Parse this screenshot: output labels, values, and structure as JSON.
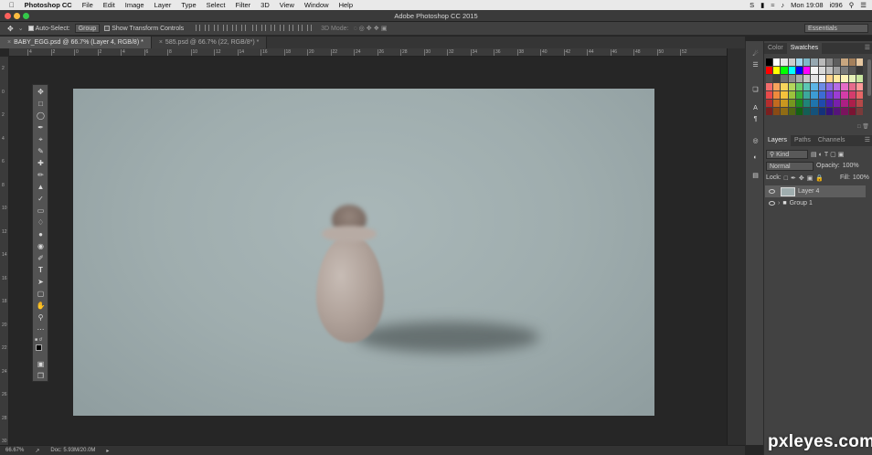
{
  "menubar": {
    "apple_icon": "apple-icon",
    "app_name": "Photoshop CC",
    "items": [
      "File",
      "Edit",
      "Image",
      "Layer",
      "Type",
      "Select",
      "Filter",
      "3D",
      "View",
      "Window",
      "Help"
    ],
    "clock": "Mon 19:08",
    "user": "i096"
  },
  "window": {
    "title": "Adobe Photoshop CC 2015"
  },
  "options": {
    "auto_select_label": "Auto-Select:",
    "auto_select_value": "Group",
    "show_transform_label": "Show Transform Controls",
    "mode_3d": "3D Mode:",
    "workspace": "Essentials"
  },
  "tabs": [
    {
      "label": "BABY_EGG.psd @ 66.7% (Layer 4, RGB/8) *",
      "active": true
    },
    {
      "label": "585.psd @ 66.7% (22, RGB/8*) *",
      "active": false
    }
  ],
  "ruler_top": [
    "4",
    "2",
    "0",
    "2",
    "4",
    "6",
    "8",
    "10",
    "12",
    "14",
    "16",
    "18",
    "20",
    "22",
    "24",
    "26",
    "28",
    "30",
    "32",
    "34",
    "36",
    "38",
    "40",
    "42",
    "44",
    "46",
    "48",
    "50",
    "52"
  ],
  "ruler_left": [
    "2",
    "0",
    "2",
    "4",
    "6",
    "8",
    "10",
    "12",
    "14",
    "16",
    "18",
    "20",
    "22",
    "24",
    "26",
    "28",
    "30"
  ],
  "status": {
    "zoom": "66.67%",
    "doc": "Doc: 5.93M/20.0M"
  },
  "color_panel": {
    "tabs": [
      "Color",
      "Swatches"
    ],
    "active": "Swatches"
  },
  "swatches": [
    "#000000",
    "#ffffff",
    "#e6e6e6",
    "#cccccc",
    "#a3d6ee",
    "#7fb8c9",
    "#96a8b0",
    "#b9b9b9",
    "#8a8a8a",
    "#5d5d5d",
    "#c8a67f",
    "#a37f5b",
    "#e6c7a0",
    "#ff0000",
    "#ffff00",
    "#00ff00",
    "#00ffff",
    "#0000ff",
    "#ff00ff",
    "#f5f5f5",
    "#d9d9d9",
    "#c0c0c0",
    "#9e9e9e",
    "#7a7a7a",
    "#585858",
    "#363636",
    "#4d4d4d",
    "#3d3d3d",
    "#6e6e6e",
    "#8c8c8c",
    "#aaaaaa",
    "#c7c7c7",
    "#e3e3e3",
    "#f2f2f2",
    "#ffd38c",
    "#ffeaa0",
    "#fff3b8",
    "#e5f0b8",
    "#c9e6a0",
    "#f26c6c",
    "#f7a35c",
    "#f7d45c",
    "#b5d65c",
    "#6ccf6c",
    "#5cc7b5",
    "#5cb5e6",
    "#6c8ce6",
    "#8c6ce6",
    "#b56ce6",
    "#e66cc7",
    "#e66c8c",
    "#ff9999",
    "#e84a4a",
    "#f08a3c",
    "#f5c23c",
    "#9cc23c",
    "#3cb03c",
    "#3ca89c",
    "#3c9cd4",
    "#3c6cd4",
    "#6c3cd4",
    "#9c3cd4",
    "#d43ca8",
    "#d43c6c",
    "#e66666",
    "#b52d2d",
    "#c26a1f",
    "#c9971f",
    "#75961f",
    "#1f8a1f",
    "#1f8478",
    "#1f75ad",
    "#1f4aad",
    "#4a1fad",
    "#781fad",
    "#ad1f84",
    "#ad1f4a",
    "#b54848",
    "#7a1f1f",
    "#8a4a14",
    "#8f6b14",
    "#4f6614",
    "#146114",
    "#145e55",
    "#14527a",
    "#14327a",
    "#32147a",
    "#55147a",
    "#7a145e",
    "#7a1432",
    "#7a3a3a"
  ],
  "layers_panel": {
    "tabs": [
      "Layers",
      "Paths",
      "Channels"
    ],
    "active": "Layers",
    "filter_label": "Kind",
    "blend_mode": "Normal",
    "opacity_label": "Opacity:",
    "opacity": "100%",
    "lock_label": "Lock:",
    "fill_label": "Fill:",
    "fill": "100%",
    "layers": [
      {
        "name": "Layer 4",
        "type": "layer",
        "selected": true
      },
      {
        "name": "Group 1",
        "type": "group",
        "selected": false
      }
    ]
  },
  "watermark": "pxleyes.com"
}
